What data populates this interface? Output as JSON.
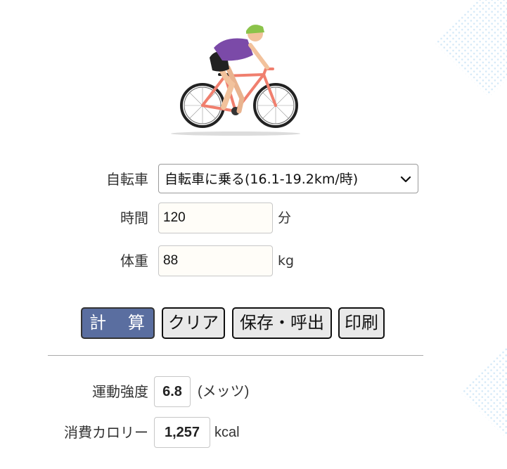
{
  "form": {
    "activity_label": "自転車",
    "activity_value": "自転車に乗る(16.1-19.2km/時)",
    "time_label": "時間",
    "time_value": "120",
    "time_unit": "分",
    "weight_label": "体重",
    "weight_value": "88",
    "weight_unit": "kg"
  },
  "buttons": {
    "calc": "計 算",
    "clear": "クリア",
    "save": "保存・呼出",
    "print": "印刷"
  },
  "results": {
    "mets_label": "運動強度",
    "mets_value": "6.8",
    "mets_unit": "(メッツ)",
    "calories_label": "消費カロリー",
    "calories_value": "1,257",
    "calories_unit": "kcal"
  },
  "colors": {
    "primary_button": "#5a6ea0",
    "input_bg": "#fffdf8",
    "bike_frame": "#f07f6e",
    "jersey": "#7b4aa8",
    "helmet": "#8bc34a"
  },
  "icons": {
    "illustration": "cyclist-illustration",
    "select_arrow": "chevron-down-icon"
  }
}
